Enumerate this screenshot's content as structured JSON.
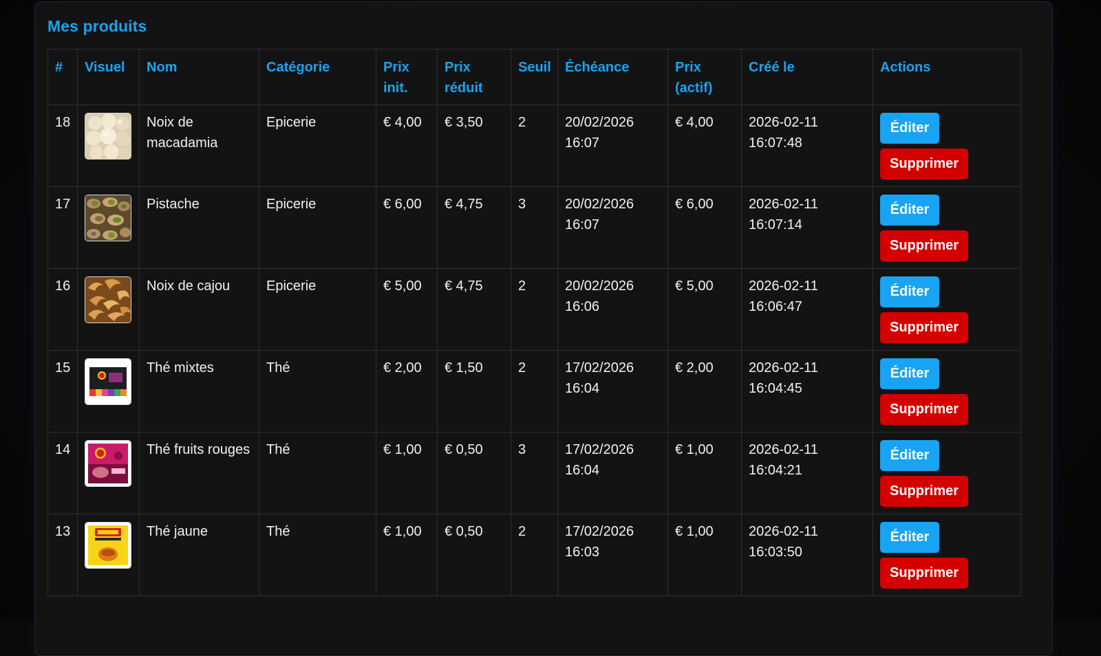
{
  "section": {
    "title": "Mes produits"
  },
  "table": {
    "headers": {
      "id": "#",
      "visual": "Visuel",
      "name": "Nom",
      "category": "Catégorie",
      "initial_price_line1": "Prix",
      "initial_price_line2": "init.",
      "reduced_price_line1": "Prix",
      "reduced_price_line2": "réduit",
      "threshold": "Seuil",
      "deadline": "Échéance",
      "active_price_line1": "Prix",
      "active_price_line2": "(actif)",
      "created": "Créé le",
      "actions": "Actions"
    },
    "rows": [
      {
        "id": "18",
        "name_line1": "Noix de",
        "name_line2": "macadamia",
        "category": "Epicerie",
        "initial_price": "€ 4,00",
        "reduced_price": "€ 3,50",
        "threshold": "2",
        "deadline_date": "20/02/2026",
        "deadline_time": "16:07",
        "active_price": "€ 4,00",
        "created_date": "2026-02-11",
        "created_time": "16:07:48",
        "thumbnail_icon": "macadamia-nuts-photo",
        "edit_label": "Éditer",
        "delete_label": "Supprimer"
      },
      {
        "id": "17",
        "name_line1": "Pistache",
        "name_line2": "",
        "category": "Epicerie",
        "initial_price": "€ 6,00",
        "reduced_price": "€ 4,75",
        "threshold": "3",
        "deadline_date": "20/02/2026",
        "deadline_time": "16:07",
        "active_price": "€ 6,00",
        "created_date": "2026-02-11",
        "created_time": "16:07:14",
        "thumbnail_icon": "pistachio-photo",
        "edit_label": "Éditer",
        "delete_label": "Supprimer"
      },
      {
        "id": "16",
        "name_line1": "Noix de cajou",
        "name_line2": "",
        "category": "Epicerie",
        "initial_price": "€ 5,00",
        "reduced_price": "€ 4,75",
        "threshold": "2",
        "deadline_date": "20/02/2026",
        "deadline_time": "16:06",
        "active_price": "€ 5,00",
        "created_date": "2026-02-11",
        "created_time": "16:06:47",
        "thumbnail_icon": "cashew-nuts-photo",
        "edit_label": "Éditer",
        "delete_label": "Supprimer"
      },
      {
        "id": "15",
        "name_line1": "Thé mixtes",
        "name_line2": "",
        "category": "Thé",
        "initial_price": "€ 2,00",
        "reduced_price": "€ 1,50",
        "threshold": "2",
        "deadline_date": "17/02/2026",
        "deadline_time": "16:04",
        "active_price": "€ 2,00",
        "created_date": "2026-02-11",
        "created_time": "16:04:45",
        "thumbnail_icon": "tea-assortment-box-photo",
        "edit_label": "Éditer",
        "delete_label": "Supprimer"
      },
      {
        "id": "14",
        "name_line1": "Thé fruits rouges",
        "name_line2": "",
        "category": "Thé",
        "initial_price": "€ 1,00",
        "reduced_price": "€ 0,50",
        "threshold": "3",
        "deadline_date": "17/02/2026",
        "deadline_time": "16:04",
        "active_price": "€ 1,00",
        "created_date": "2026-02-11",
        "created_time": "16:04:21",
        "thumbnail_icon": "red-fruit-tea-box-photo",
        "edit_label": "Éditer",
        "delete_label": "Supprimer"
      },
      {
        "id": "13",
        "name_line1": "Thé jaune",
        "name_line2": "",
        "category": "Thé",
        "initial_price": "€ 1,00",
        "reduced_price": "€ 0,50",
        "threshold": "2",
        "deadline_date": "17/02/2026",
        "deadline_time": "16:03",
        "active_price": "€ 1,00",
        "created_date": "2026-02-11",
        "created_time": "16:03:50",
        "thumbnail_icon": "yellow-label-tea-box-photo",
        "edit_label": "Éditer",
        "delete_label": "Supprimer"
      }
    ]
  },
  "colors": {
    "accent": "#1aa3f0",
    "edit_button": "#19a4f3",
    "delete_button": "#d40000",
    "panel_background": "#131314",
    "page_background": "#0a0a0b"
  }
}
